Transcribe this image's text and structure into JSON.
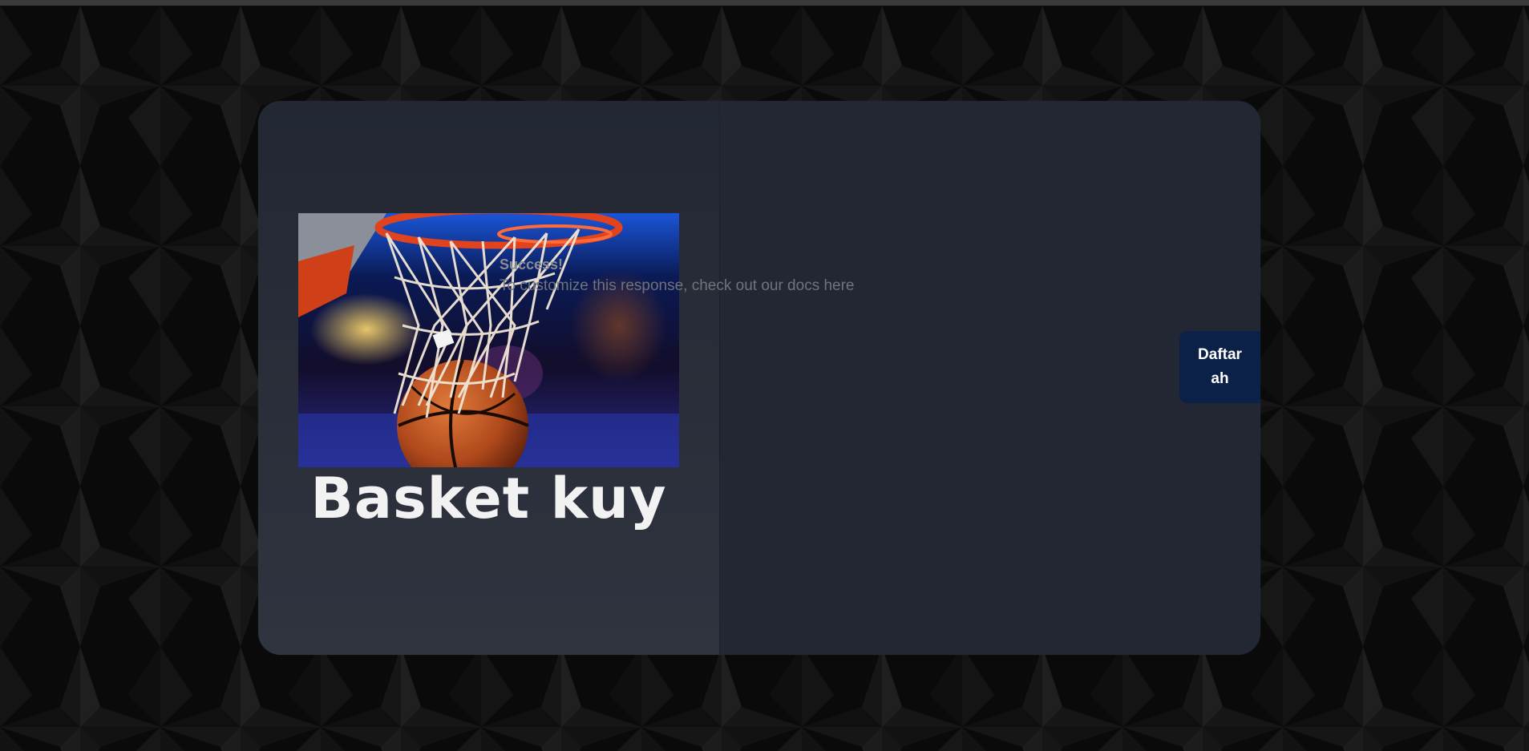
{
  "colors": {
    "page_background": "#0b0b0b",
    "card_background": "#222733",
    "button_background": "#0c2148",
    "message_title": "#8a8d94",
    "message_body": "#6f737b"
  },
  "hero": {
    "image_name": "basketball-through-hoop-photo",
    "logo_text": "Basket kuy"
  },
  "message": {
    "title": "Success!",
    "body": "To customize this response, check out our docs here"
  },
  "cta": {
    "line1": "Daftar",
    "line2": "ah"
  }
}
